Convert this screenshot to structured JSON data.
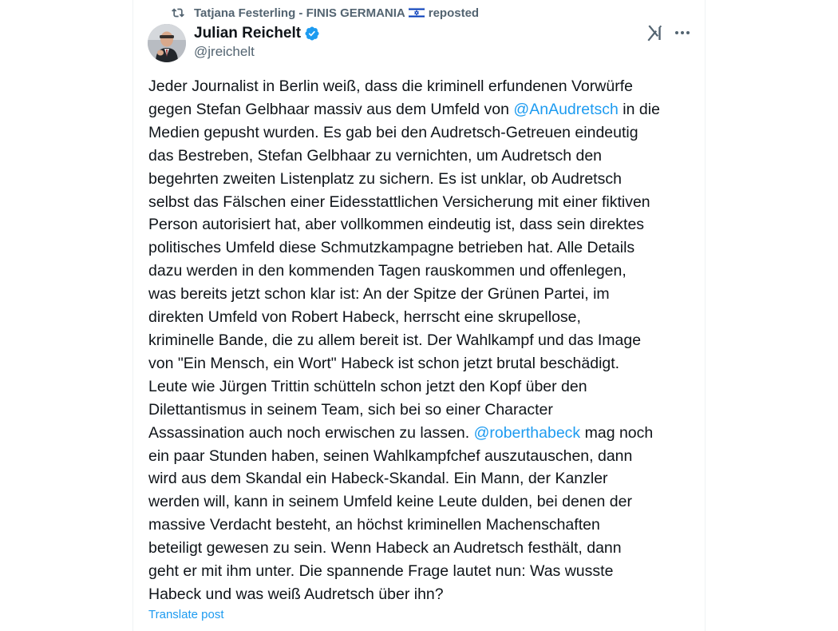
{
  "repost": {
    "prefix": "Tatjana Festerling - FINIS GERMANIA",
    "suffix": "reposted"
  },
  "author": {
    "name": "Julian Reichelt",
    "handle": "@jreichelt"
  },
  "post": {
    "lines": [
      {
        "segments": [
          {
            "text": "Jeder Journalist in Berlin weiß, dass die kriminell erfundenen Vorwürfe"
          }
        ]
      },
      {
        "segments": [
          {
            "text": "gegen Stefan Gelbhaar massiv aus dem Umfeld von "
          },
          {
            "text": "@AnAudretsch",
            "mention": true
          },
          {
            "text": " in die"
          }
        ]
      },
      {
        "segments": [
          {
            "text": "Medien gepusht wurden. Es gab bei den Audretsch-Getreuen eindeutig"
          }
        ]
      },
      {
        "segments": [
          {
            "text": "das Bestreben, Stefan Gelbhaar zu vernichten, um Audretsch den"
          }
        ]
      },
      {
        "segments": [
          {
            "text": "begehrten zweiten Listenplatz zu sichern. Es ist unklar, ob Audretsch"
          }
        ]
      },
      {
        "segments": [
          {
            "text": "selbst das Fälschen einer Eidesstattlichen Versicherung mit einer fiktiven"
          }
        ]
      },
      {
        "segments": [
          {
            "text": "Person autorisiert hat, aber vollkommen eindeutig ist, dass sein direktes"
          }
        ]
      },
      {
        "segments": [
          {
            "text": "politisches Umfeld diese Schmutzkampagne betrieben hat. Alle Details"
          }
        ]
      },
      {
        "segments": [
          {
            "text": "dazu werden in den kommenden Tagen rauskommen und offenlegen,"
          }
        ]
      },
      {
        "segments": [
          {
            "text": "was bereits jetzt schon klar ist: An der Spitze der Grünen Partei, im"
          }
        ]
      },
      {
        "segments": [
          {
            "text": "direkten Umfeld von Robert Habeck, herrscht eine skrupellose,"
          }
        ]
      },
      {
        "segments": [
          {
            "text": "kriminelle Bande, die zu allem bereit ist. Der Wahlkampf und das Image"
          }
        ]
      },
      {
        "segments": [
          {
            "text": "von \"Ein Mensch, ein Wort\" Habeck ist schon jetzt brutal beschädigt."
          }
        ]
      },
      {
        "segments": [
          {
            "text": "Leute wie Jürgen Trittin schütteln schon jetzt den Kopf über den"
          }
        ]
      },
      {
        "segments": [
          {
            "text": "Dilettantismus in seinem Team, sich bei so einer Character"
          }
        ]
      },
      {
        "segments": [
          {
            "text": "Assassination auch noch erwischen zu lassen. "
          },
          {
            "text": "@roberthabeck",
            "mention": true
          },
          {
            "text": " mag noch"
          }
        ]
      },
      {
        "segments": [
          {
            "text": "ein paar Stunden haben, seinen Wahlkampfchef auszutauschen, dann"
          }
        ]
      },
      {
        "segments": [
          {
            "text": "wird aus dem Skandal ein Habeck-Skandal. Ein Mann, der Kanzler"
          }
        ]
      },
      {
        "segments": [
          {
            "text": "werden will, kann in seinem Umfeld keine Leute dulden, bei denen der"
          }
        ]
      },
      {
        "segments": [
          {
            "text": "massive Verdacht besteht, an höchst kriminellen Machenschaften"
          }
        ]
      },
      {
        "segments": [
          {
            "text": "beteiligt gewesen zu sein. Wenn Habeck an Audretsch festhält, dann"
          }
        ]
      },
      {
        "segments": [
          {
            "text": "geht er mit ihm unter. Die spannende Frage lautet nun: Was wusste"
          }
        ]
      },
      {
        "segments": [
          {
            "text": "Habeck und was weiß Audretsch über ihn?"
          }
        ]
      }
    ],
    "translate_label": "Translate post"
  },
  "icons": {
    "repost": "repost-icon",
    "flag": "israel-flag-icon",
    "verified": "verified-badge-icon",
    "grok": "grok-icon",
    "more": "more-options-icon"
  },
  "colors": {
    "text": "#0f1419",
    "secondary": "#536471",
    "link": "#1d9bf0",
    "verified": "#1d9bf0"
  }
}
